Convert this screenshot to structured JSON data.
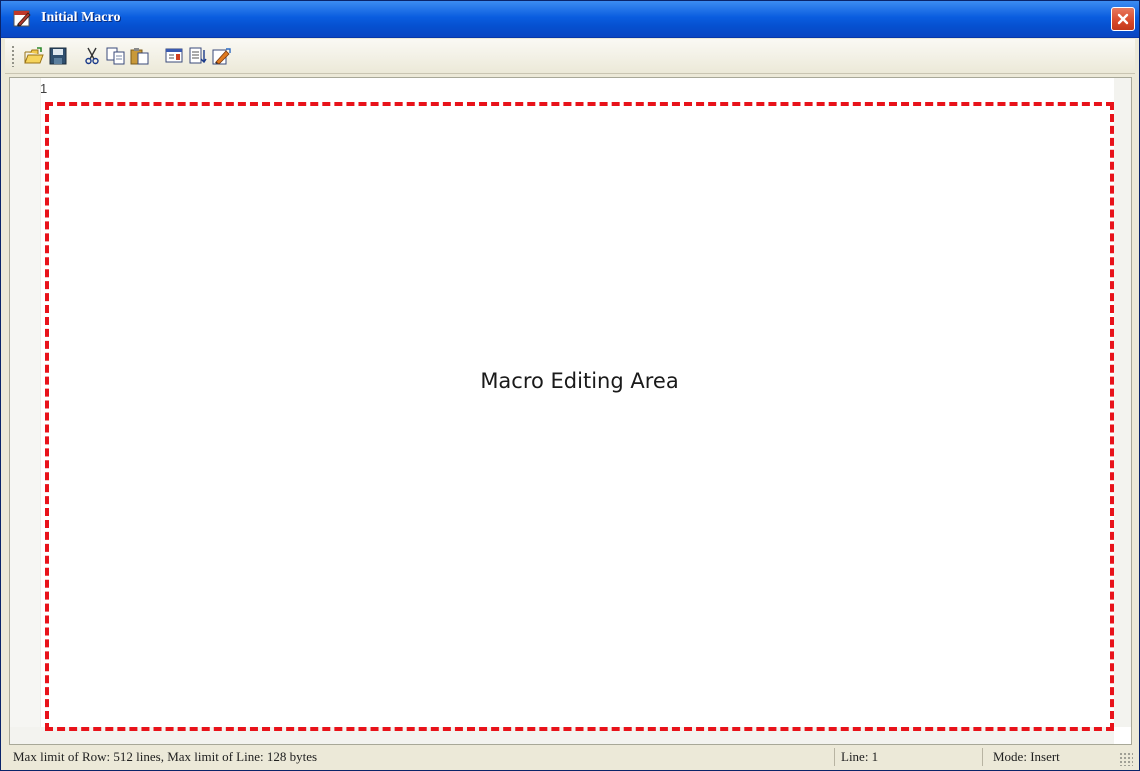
{
  "window": {
    "title": "Initial Macro",
    "accent_color": "#0a5ddf",
    "close_icon": "close-icon"
  },
  "toolbar": {
    "buttons": [
      {
        "name": "open-icon"
      },
      {
        "name": "save-icon"
      },
      {
        "name": "cut-icon"
      },
      {
        "name": "copy-icon"
      },
      {
        "name": "paste-icon"
      },
      {
        "name": "find-icon"
      },
      {
        "name": "goto-line-icon"
      },
      {
        "name": "compile-icon"
      }
    ]
  },
  "editor": {
    "line_number": "1",
    "area_label": "Macro Editing Area",
    "highlight_color": "#e8121a"
  },
  "statusbar": {
    "limits": "Max limit of Row: 512 lines, Max limit of Line: 128 bytes",
    "line": "Line: 1",
    "mode": "Mode: Insert"
  }
}
